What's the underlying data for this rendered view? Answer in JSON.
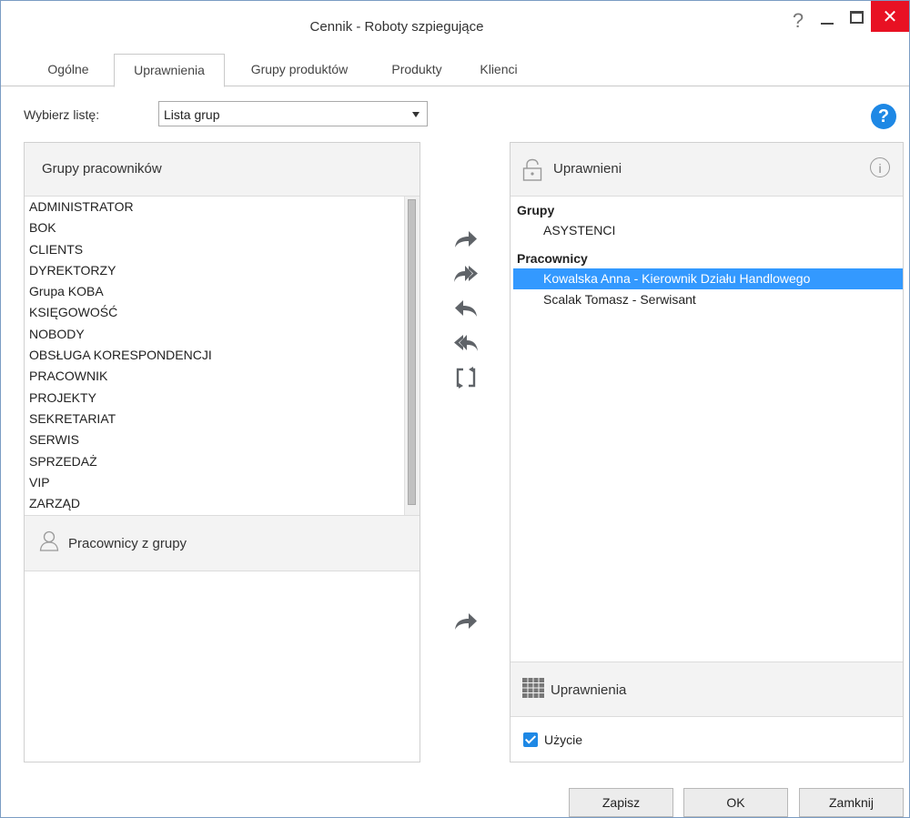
{
  "window": {
    "title": "Cennik - Roboty szpiegujące",
    "help_glyph": "?",
    "close_glyph": "✕"
  },
  "tabs": [
    {
      "label": "Ogólne"
    },
    {
      "label": "Uprawnienia",
      "active": true
    },
    {
      "label": "Grupy produktów"
    },
    {
      "label": "Produkty"
    },
    {
      "label": "Klienci"
    }
  ],
  "list_selector": {
    "label": "Wybierz listę:",
    "value": "Lista grup",
    "help_icon": "?"
  },
  "groups_panel": {
    "title": "Grupy pracowników",
    "items": [
      "ADMINISTRATOR",
      "BOK",
      "CLIENTS",
      "DYREKTORZY",
      "Grupa KOBA",
      "KSIĘGOWOŚĆ",
      "NOBODY",
      "OBSŁUGA KORESPONDENCJI",
      "PRACOWNIK",
      "PROJEKTY",
      "SEKRETARIAT",
      "SERWIS",
      "SPRZEDAŻ",
      "VIP",
      "ZARZĄD"
    ]
  },
  "members_panel": {
    "title": "Pracownicy z grupy"
  },
  "authorized_panel": {
    "title": "Uprawnieni",
    "info_glyph": "i",
    "groups_label": "Grupy",
    "groups": [
      "ASYSTENCI"
    ],
    "employees_label": "Pracownicy",
    "employees": [
      {
        "name": "Kowalska Anna - Kierownik Działu Handlowego",
        "selected": true
      },
      {
        "name": "Scalak Tomasz - Serwisant",
        "selected": false
      }
    ]
  },
  "permissions_panel": {
    "title": "Uprawnienia",
    "usage_label": "Użycie",
    "usage_checked": true
  },
  "buttons": {
    "save": "Zapisz",
    "ok": "OK",
    "close": "Zamknij"
  },
  "colors": {
    "accent": "#1e88e5",
    "selection": "#3399ff",
    "close_red": "#e81123"
  }
}
